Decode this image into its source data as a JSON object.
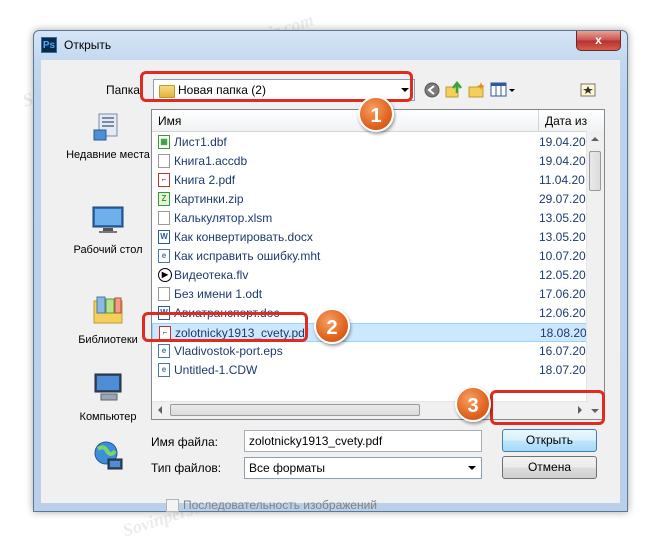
{
  "window": {
    "title": "Открыть",
    "app_icon_text": "Ps",
    "close_label": "x"
  },
  "toolbar": {
    "folder_label": "Папка:",
    "current_folder": "Новая папка (2)",
    "icons": [
      "back-icon",
      "up-folder-icon",
      "new-folder-icon",
      "view-menu-icon",
      "desktop-icon"
    ]
  },
  "places": [
    {
      "label": "Недавние места",
      "icon": "recent-places-icon"
    },
    {
      "label": "Рабочий стол",
      "icon": "desktop-icon"
    },
    {
      "label": "Библиотеки",
      "icon": "libraries-icon"
    },
    {
      "label": "Компьютер",
      "icon": "computer-icon"
    },
    {
      "label": "",
      "icon": "network-icon"
    }
  ],
  "list": {
    "columns": {
      "name": "Имя",
      "date": "Дата из"
    },
    "rows": [
      {
        "name": "Лист1.dbf",
        "date": "19.04.20",
        "type": "dbf"
      },
      {
        "name": "Книга1.accdb",
        "date": "19.04.20",
        "type": "accdb"
      },
      {
        "name": "Книга 2.pdf",
        "date": "11.04.20",
        "type": "pdf"
      },
      {
        "name": "Картинки.zip",
        "date": "29.07.20",
        "type": "zip"
      },
      {
        "name": "Калькулятор.xlsm",
        "date": "13.05.20",
        "type": "xlsm"
      },
      {
        "name": "Как конвертировать.docx",
        "date": "13.05.20",
        "type": "docx"
      },
      {
        "name": "Как исправить ошибку.mht",
        "date": "10.07.20",
        "type": "mht"
      },
      {
        "name": "Видеотека.flv",
        "date": "12.05.20",
        "type": "flv"
      },
      {
        "name": "Без имени 1.odt",
        "date": "17.06.20",
        "type": "odt"
      },
      {
        "name": "Авиатранспорт.doc",
        "date": "12.06.20",
        "type": "doc"
      },
      {
        "name": "zolotnicky1913_cvety.pdf",
        "date": "18.08.20",
        "type": "pdf",
        "selected": true
      },
      {
        "name": "Vladivostok-port.eps",
        "date": "16.07.20",
        "type": "eps"
      },
      {
        "name": "Untitled-1.CDW",
        "date": "18.07.20",
        "type": "cdw"
      }
    ]
  },
  "filename": {
    "label": "Имя файла:",
    "value": "zolotnicky1913_cvety.pdf"
  },
  "filetype": {
    "label": "Тип файлов:",
    "value": "Все форматы"
  },
  "buttons": {
    "open": "Открыть",
    "cancel": "Отмена"
  },
  "sequence_checkbox": {
    "label": "Последовательность изображений",
    "checked": false
  },
  "annotations": [
    "1",
    "2",
    "3"
  ],
  "watermark": "Sovinpersovir.com",
  "colors": {
    "highlight": "#e02b20",
    "badge": "#e0641f",
    "selection": "#cce8ff"
  }
}
